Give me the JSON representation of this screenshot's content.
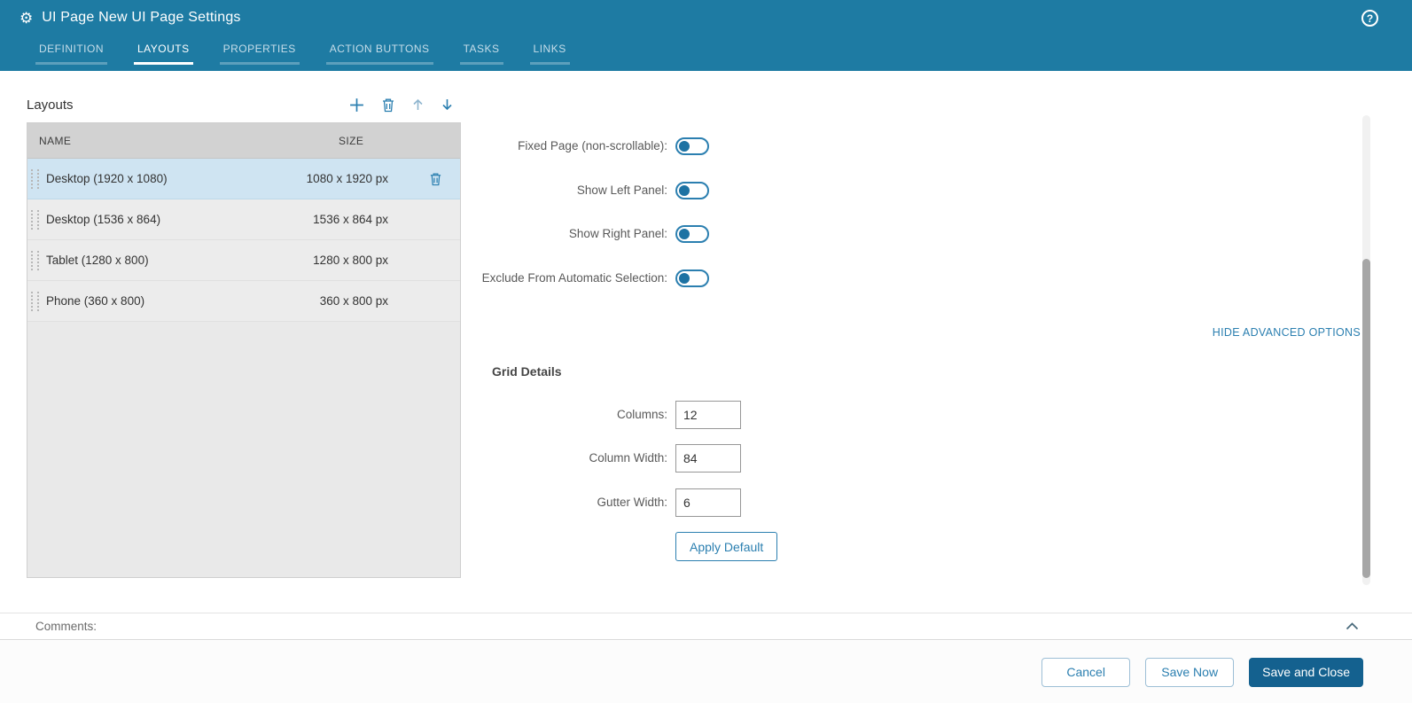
{
  "colors": {
    "header_bg": "#1E7BA3",
    "accent": "#2B7FB0",
    "selected_row_bg": "#CFE4F2",
    "primary_button_bg": "#14618F"
  },
  "header": {
    "title": "UI Page New UI Page Settings",
    "icons": {
      "left": "gear-icon",
      "right": "help-icon"
    },
    "help_glyph": "?",
    "gear_glyph": "⚙",
    "tabs": [
      {
        "label": "DEFINITION",
        "active": false
      },
      {
        "label": "LAYOUTS",
        "active": true
      },
      {
        "label": "PROPERTIES",
        "active": false
      },
      {
        "label": "ACTION BUTTONS",
        "active": false
      },
      {
        "label": "TASKS",
        "active": false
      },
      {
        "label": "LINKS",
        "active": false
      }
    ]
  },
  "layouts": {
    "title": "Layouts",
    "toolbar_icons": [
      "add-icon",
      "trash-icon",
      "arrow-up-icon",
      "arrow-down-icon"
    ],
    "columns": {
      "name": "NAME",
      "size": "SIZE"
    },
    "rows": [
      {
        "name": "Desktop (1920 x 1080)",
        "size": "1080 x 1920 px",
        "selected": true
      },
      {
        "name": "Desktop (1536 x 864)",
        "size": "1536 x 864 px",
        "selected": false
      },
      {
        "name": "Tablet (1280 x 800)",
        "size": "1280 x 800 px",
        "selected": false
      },
      {
        "name": "Phone (360 x 800)",
        "size": "360 x 800 px",
        "selected": false
      }
    ]
  },
  "settings": {
    "toggles": [
      {
        "label": "Fixed Page (non-scrollable):",
        "state": "off"
      },
      {
        "label": "Show Left Panel:",
        "state": "off"
      },
      {
        "label": "Show Right Panel:",
        "state": "off"
      },
      {
        "label": "Exclude From Automatic Selection:",
        "state": "off"
      }
    ],
    "advanced_options_link": "HIDE ADVANCED OPTIONS",
    "grid_details": {
      "title": "Grid Details",
      "fields": [
        {
          "label": "Columns:",
          "value": "12"
        },
        {
          "label": "Column Width:",
          "value": "84"
        },
        {
          "label": "Gutter Width:",
          "value": "6"
        }
      ],
      "apply_button_label": "Apply Default"
    }
  },
  "comments": {
    "label": "Comments:"
  },
  "footer": {
    "cancel_label": "Cancel",
    "save_now_label": "Save Now",
    "save_close_label": "Save and Close"
  }
}
